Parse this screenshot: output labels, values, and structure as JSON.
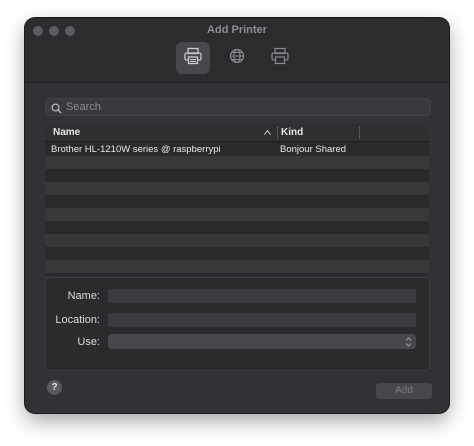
{
  "window": {
    "title": "Add Printer"
  },
  "toolbar": {
    "buttons": [
      {
        "icon": "printer-icon",
        "active": true
      },
      {
        "icon": "globe-icon",
        "active": false
      },
      {
        "icon": "windows-printer-icon",
        "active": false
      }
    ]
  },
  "search": {
    "placeholder": "Search",
    "value": ""
  },
  "table": {
    "columns": [
      {
        "label": "Name",
        "sort": "ascending"
      },
      {
        "label": "Kind"
      }
    ],
    "rows": [
      {
        "name": "Brother HL-1210W series @ raspberrypi",
        "kind": "Bonjour Shared"
      }
    ]
  },
  "form": {
    "name_label": "Name:",
    "name_value": "",
    "location_label": "Location:",
    "location_value": "",
    "use_label": "Use:",
    "use_value": ""
  },
  "footer": {
    "help_label": "?",
    "add_label": "Add"
  },
  "colors": {
    "window_bg": "#323236",
    "row_alt": "#38383b",
    "selected_tool": "#47474c"
  }
}
